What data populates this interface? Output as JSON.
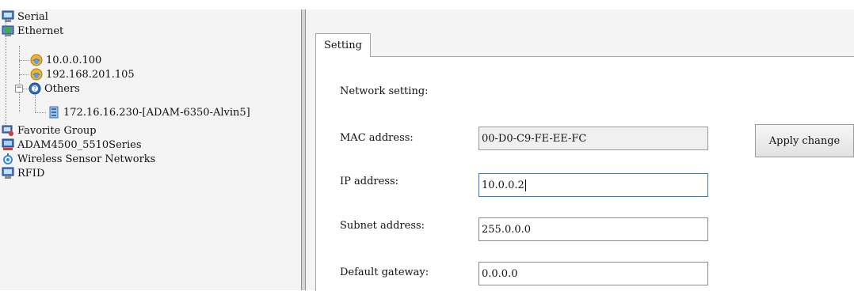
{
  "tree": {
    "items": [
      {
        "label": "Serial",
        "icon": "serial-computer-icon"
      },
      {
        "label": "Ethernet",
        "icon": "ethernet-globe-icon"
      },
      {
        "label": "10.0.0.100",
        "icon": "network-device-icon"
      },
      {
        "label": "192.168.201.105",
        "icon": "network-device-icon"
      },
      {
        "label": "Others",
        "icon": "question-globe-icon"
      },
      {
        "label": "172.16.16.230-[ADAM-6350-Alvin5]",
        "icon": "adam-module-icon"
      },
      {
        "label": "Favorite Group",
        "icon": "favorite-group-icon"
      },
      {
        "label": "ADAM4500_5510Series",
        "icon": "adam-series-icon"
      },
      {
        "label": "Wireless Sensor Networks",
        "icon": "wireless-sensor-icon"
      },
      {
        "label": "RFID",
        "icon": "rfid-computer-icon"
      }
    ],
    "expander_symbol": "−"
  },
  "tabs": [
    {
      "label": "Setting"
    }
  ],
  "form": {
    "section_label": "Network setting:",
    "apply_label": "Apply change",
    "fields": [
      {
        "label": "MAC address:",
        "value": "00-D0-C9-FE-EE-FC",
        "readonly": true
      },
      {
        "label": "IP address:",
        "value": "10.0.0.2",
        "focused": true
      },
      {
        "label": "Subnet address:",
        "value": "255.0.0.0"
      },
      {
        "label": "Default gateway:",
        "value": "0.0.0.0"
      }
    ]
  },
  "colors": {
    "focus_border": "#2a7cd4",
    "panel_bg": "#f4f4f4"
  }
}
